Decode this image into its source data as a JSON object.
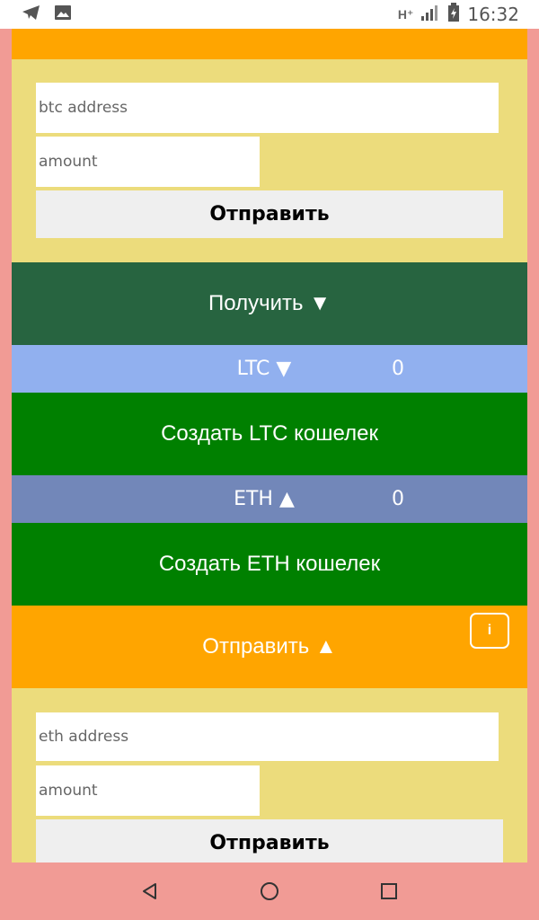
{
  "status_bar": {
    "network": "H⁺",
    "time": "16:32"
  },
  "btc_send": {
    "address_placeholder": "btc address",
    "amount_placeholder": "amount",
    "button_label": "Отправить"
  },
  "receive": {
    "header": "Получить  ▼",
    "wallets": [
      {
        "currency_label": "LTC ▼",
        "balance": "0",
        "create_label": "Создать LTC кошелек"
      },
      {
        "currency_label": "ETH ▲",
        "balance": "0",
        "create_label": "Создать ETH кошелек"
      }
    ]
  },
  "eth_send": {
    "header": "Отправить  ▲",
    "info_label": "i",
    "address_placeholder": "eth address",
    "amount_placeholder": "amount",
    "button_label": "Отправить"
  },
  "colors": {
    "orange": "#ffa500",
    "panel": "#ecdc7c",
    "receive_header": "#276440",
    "create_wallet": "#008000",
    "ltc_row": "#91b0ef",
    "eth_row": "#7287b9",
    "background": "#f19b95"
  }
}
